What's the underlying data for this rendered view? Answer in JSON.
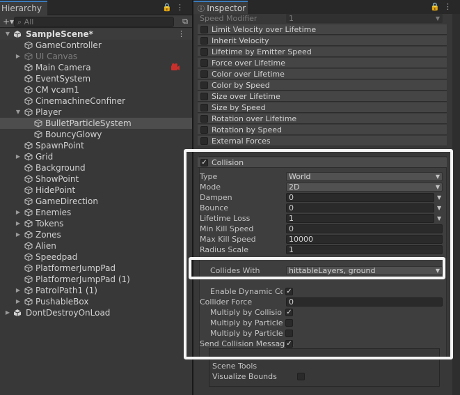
{
  "hierarchy": {
    "title": "Hierarchy",
    "search_placeholder": "All",
    "items": [
      {
        "label": "SampleScene*",
        "icon": "unity-scene-icon"
      },
      {
        "label": "GameController",
        "icon": "gameobject-cube-icon"
      },
      {
        "label": "UI Canvas",
        "icon": "gameobject-cube-icon"
      },
      {
        "label": "Main Camera",
        "icon": "gameobject-cube-icon"
      },
      {
        "label": "EventSystem",
        "icon": "gameobject-cube-icon"
      },
      {
        "label": "CM vcam1",
        "icon": "gameobject-cube-icon"
      },
      {
        "label": "CinemachineConfiner",
        "icon": "gameobject-cube-icon"
      },
      {
        "label": "Player",
        "icon": "gameobject-cube-icon"
      },
      {
        "label": "BulletParticleSystem",
        "icon": "gameobject-cube-icon"
      },
      {
        "label": "BouncyGlowy",
        "icon": "gameobject-cube-icon"
      },
      {
        "label": "SpawnPoint",
        "icon": "gameobject-cube-icon"
      },
      {
        "label": "Grid",
        "icon": "gameobject-cube-icon"
      },
      {
        "label": "Background",
        "icon": "gameobject-cube-icon"
      },
      {
        "label": "ShowPoint",
        "icon": "gameobject-cube-icon"
      },
      {
        "label": "HidePoint",
        "icon": "gameobject-cube-icon"
      },
      {
        "label": "GameDirection",
        "icon": "gameobject-cube-icon"
      },
      {
        "label": "Enemies",
        "icon": "gameobject-cube-icon"
      },
      {
        "label": "Tokens",
        "icon": "gameobject-cube-icon"
      },
      {
        "label": "Zones",
        "icon": "gameobject-cube-icon"
      },
      {
        "label": "Alien",
        "icon": "gameobject-cube-icon"
      },
      {
        "label": "Speedpad",
        "icon": "gameobject-cube-icon"
      },
      {
        "label": "PlatformerJumpPad",
        "icon": "gameobject-cube-icon"
      },
      {
        "label": "PlatformerJumpPad (1)",
        "icon": "gameobject-cube-icon"
      },
      {
        "label": "PatrolPath1 (1)",
        "icon": "gameobject-cube-icon"
      },
      {
        "label": "PushableBox",
        "icon": "gameobject-cube-icon"
      },
      {
        "label": "DontDestroyOnLoad",
        "icon": "unity-scene-icon"
      }
    ]
  },
  "inspector": {
    "title": "Inspector",
    "speed_modifier_label": "Speed Modifier",
    "speed_modifier_value": "1",
    "modules": [
      "Limit Velocity over Lifetime",
      "Inherit Velocity",
      "Lifetime by Emitter Speed",
      "Force over Lifetime",
      "Color over Lifetime",
      "Color by Speed",
      "Size over Lifetime",
      "Size by Speed",
      "Rotation over Lifetime",
      "Rotation by Speed",
      "External Forces"
    ],
    "collision": {
      "title": "Collision",
      "fields": [
        {
          "label": "Type",
          "value": "World"
        },
        {
          "label": "Mode",
          "value": "2D"
        },
        {
          "label": "Dampen",
          "value": "0"
        },
        {
          "label": "Bounce",
          "value": "0"
        },
        {
          "label": "Lifetime Loss",
          "value": "1"
        },
        {
          "label": "Min Kill Speed",
          "value": "0"
        },
        {
          "label": "Max Kill Speed",
          "value": "10000"
        },
        {
          "label": "Radius Scale",
          "value": "1"
        }
      ],
      "collides_with_label": "Collides With",
      "collides_with_value": "hittableLayers, ground",
      "enable_dynamic_label": "Enable Dynamic Collid",
      "collider_force_label": "Collider Force",
      "collider_force_value": "0",
      "mult_angle_label": "Multiply by Collision An",
      "mult_speed_label": "Multiply by Particle Sp",
      "mult_size_label": "Multiply by Particle Siz",
      "send_messages_label": "Send Collision Messages",
      "scene_tools_label": "Scene Tools",
      "visualize_bounds_label": "Visualize Bounds"
    }
  },
  "colors": {
    "accent": "#3a79bb",
    "panel": "#383838",
    "highlight": "#f5f5f5"
  }
}
